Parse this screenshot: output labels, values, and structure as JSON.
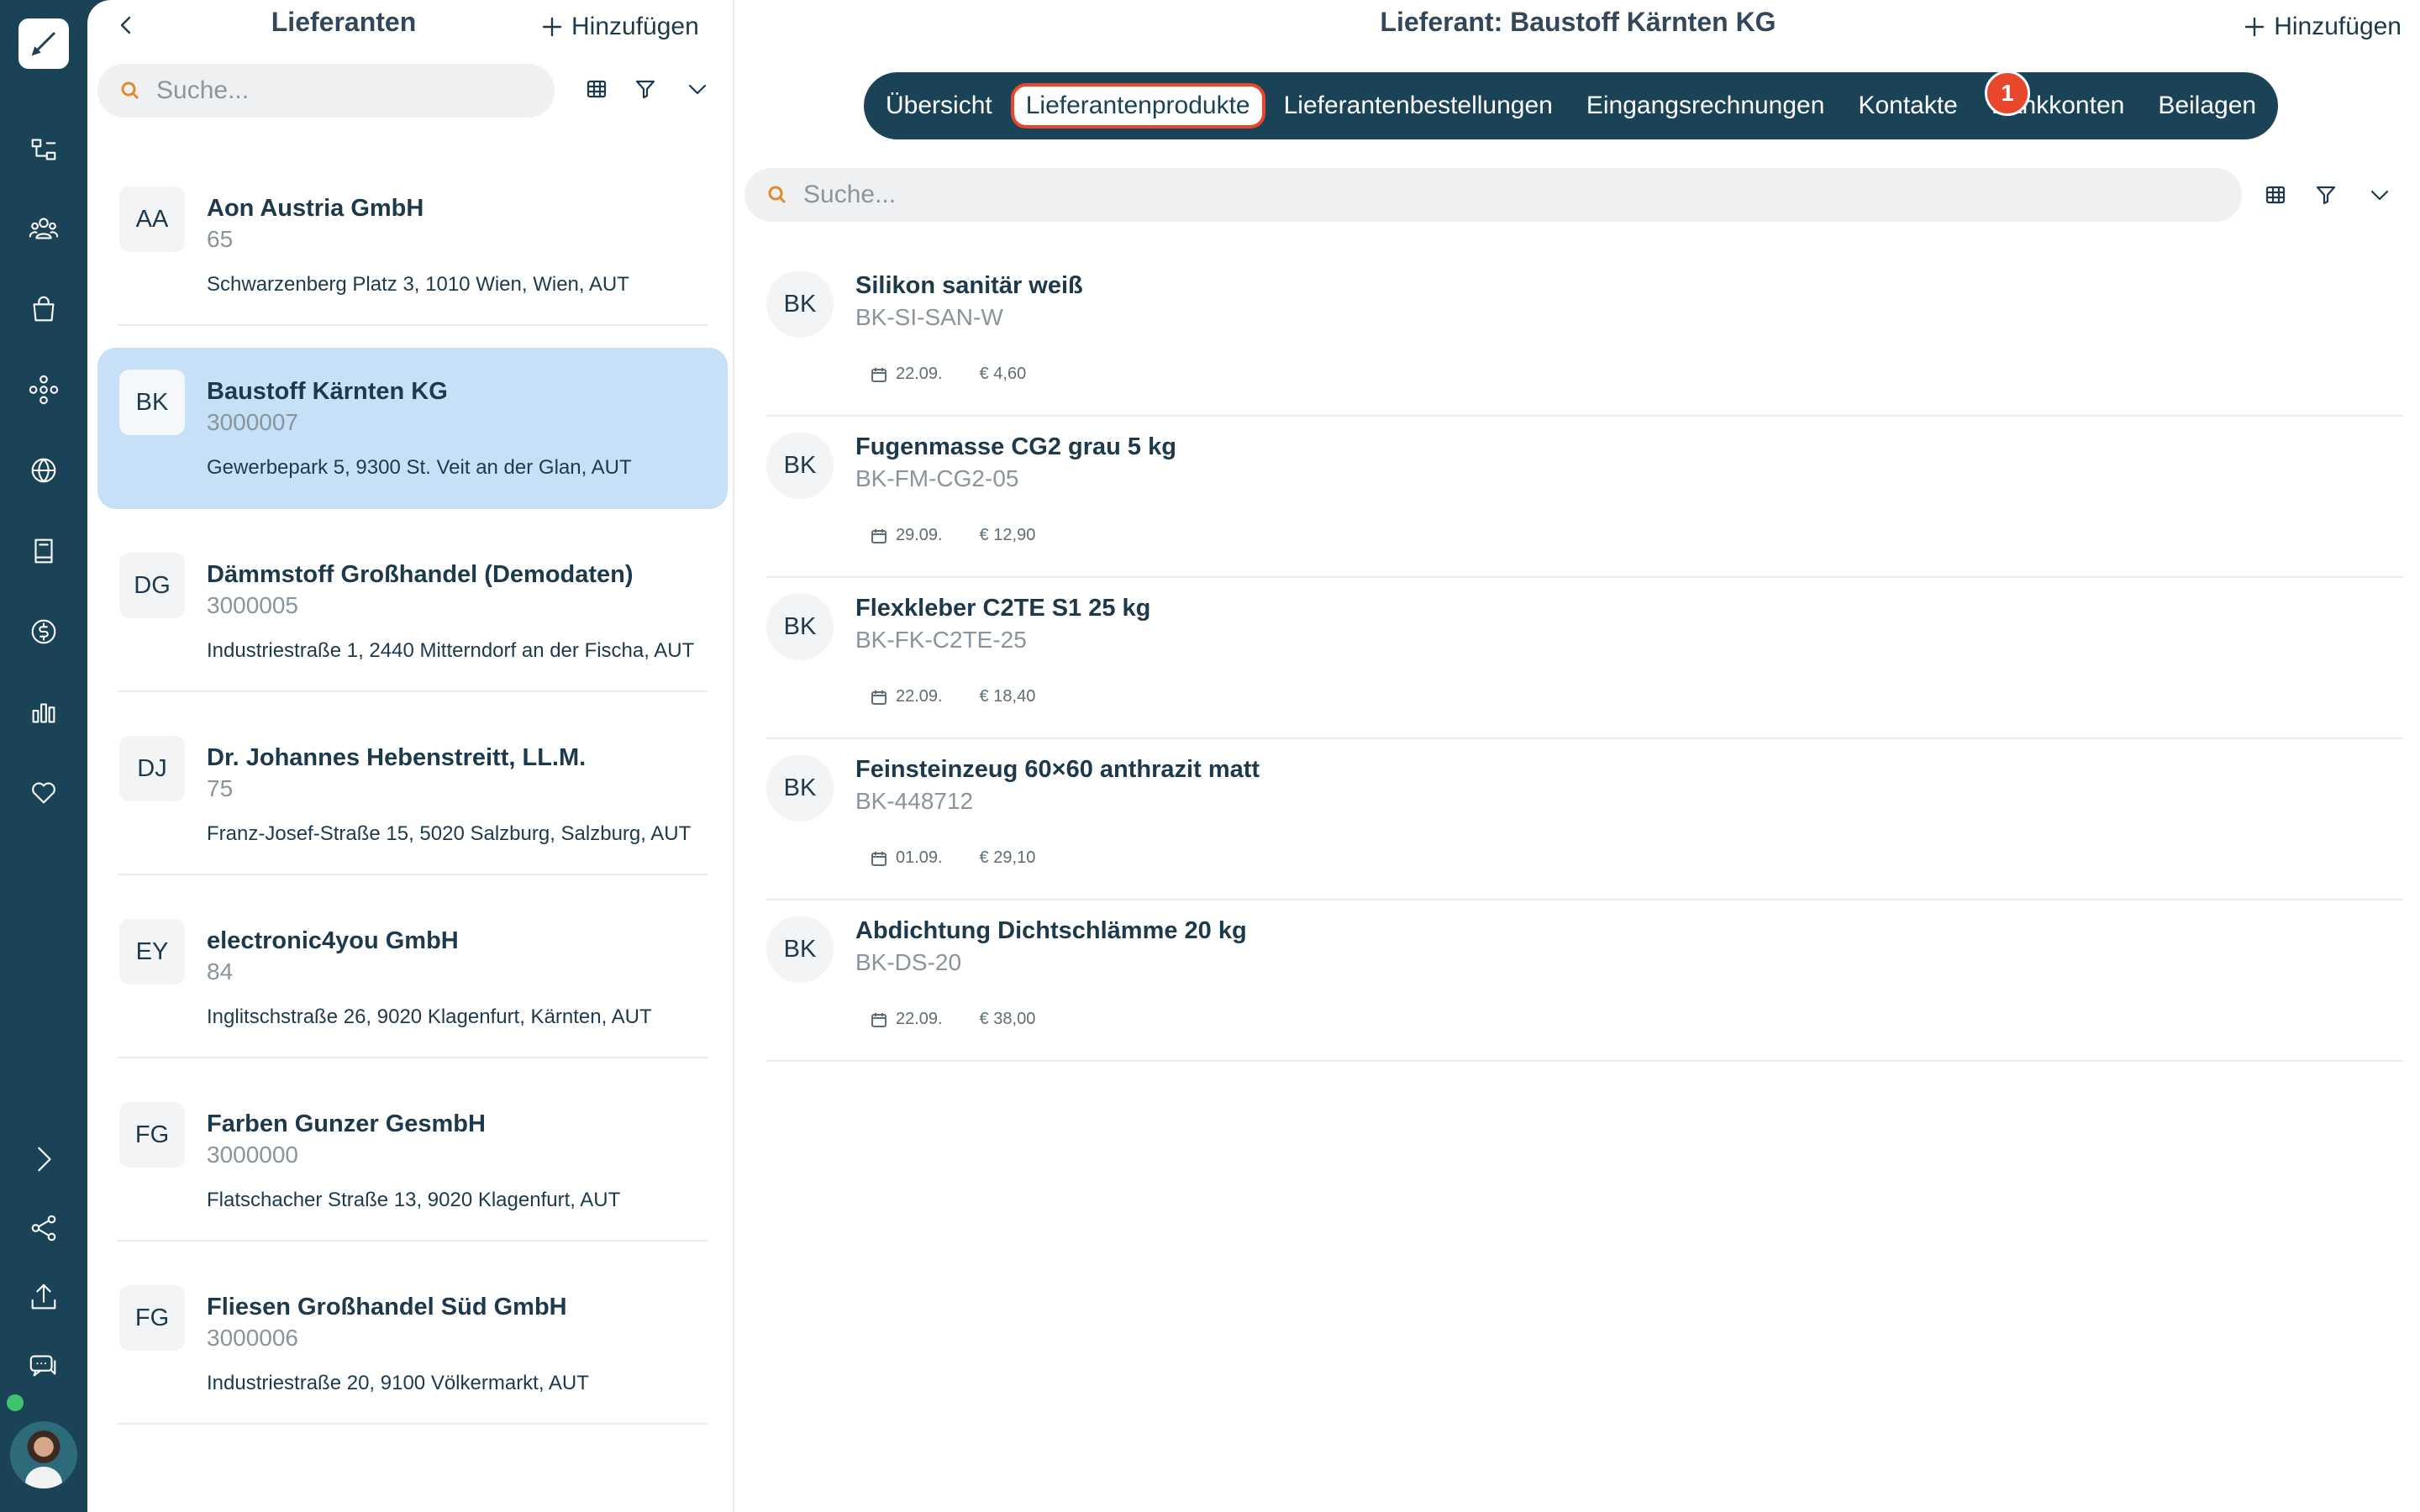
{
  "nav": {
    "items": [
      "dashboard",
      "organization",
      "users",
      "shop",
      "network",
      "globe",
      "book",
      "finance",
      "reports",
      "favorites"
    ],
    "bottom": [
      "expand",
      "share",
      "upload",
      "chat"
    ]
  },
  "list": {
    "title": "Lieferanten",
    "add_label": "Hinzufügen",
    "search_placeholder": "Suche...",
    "suppliers": [
      {
        "initials": "AA",
        "name": "Aon Austria GmbH",
        "number": "65",
        "address": "Schwarzenberg Platz 3, 1010 Wien, Wien, AUT",
        "selected": false
      },
      {
        "initials": "BK",
        "name": "Baustoff Kärnten KG",
        "number": "3000007",
        "address": "Gewerbepark 5, 9300 St. Veit an der Glan, AUT",
        "selected": true
      },
      {
        "initials": "DG",
        "name": "Dämmstoff Großhandel (Demodaten)",
        "number": "3000005",
        "address": "Industriestraße 1, 2440 Mitterndorf an der Fischa, AUT",
        "selected": false
      },
      {
        "initials": "DJ",
        "name": "Dr. Johannes Hebenstreitt, LL.M.",
        "number": "75",
        "address": "Franz-Josef-Straße 15, 5020 Salzburg, Salzburg, AUT",
        "selected": false
      },
      {
        "initials": "EY",
        "name": "electronic4you GmbH",
        "number": "84",
        "address": "Inglitschstraße 26, 9020 Klagenfurt, Kärnten, AUT",
        "selected": false
      },
      {
        "initials": "FG",
        "name": "Farben Gunzer GesmbH",
        "number": "3000000",
        "address": "Flatschacher Straße 13, 9020 Klagenfurt, AUT",
        "selected": false
      },
      {
        "initials": "FG",
        "name": "Fliesen Großhandel Süd GmbH",
        "number": "3000006",
        "address": "Industriestraße 20, 9100 Völkermarkt, AUT",
        "selected": false
      }
    ]
  },
  "detail": {
    "title": "Lieferant: Baustoff Kärnten KG",
    "add_label": "Hinzufügen",
    "search_placeholder": "Suche...",
    "tabs": [
      "Übersicht",
      "Lieferantenprodukte",
      "Lieferantenbestellungen",
      "Eingangsrechnungen",
      "Kontakte",
      "Bankkonten",
      "Beilagen"
    ],
    "active_tab": 1,
    "badge": "1",
    "highlight_color": "#e8472b",
    "products": [
      {
        "initials": "BK",
        "name": "Silikon sanitär weiß",
        "sku": "BK-SI-SAN-W",
        "date": "22.09.",
        "price": "€ 4,60"
      },
      {
        "initials": "BK",
        "name": "Fugenmasse CG2 grau 5 kg",
        "sku": "BK-FM-CG2-05",
        "date": "29.09.",
        "price": "€ 12,90"
      },
      {
        "initials": "BK",
        "name": "Flexkleber C2TE S1 25 kg",
        "sku": "BK-FK-C2TE-25",
        "date": "22.09.",
        "price": "€ 18,40"
      },
      {
        "initials": "BK",
        "name": "Feinsteinzeug 60×60 anthrazit matt",
        "sku": "BK-448712",
        "date": "01.09.",
        "price": "€ 29,10"
      },
      {
        "initials": "BK",
        "name": "Abdichtung Dichtschlämme 20 kg",
        "sku": "BK-DS-20",
        "date": "22.09.",
        "price": "€ 38,00"
      }
    ]
  },
  "colors": {
    "sidebar": "#1b4358",
    "selected_row": "#c6e0f8",
    "search_icon": "#e08a2c",
    "online": "#3ec46d"
  }
}
